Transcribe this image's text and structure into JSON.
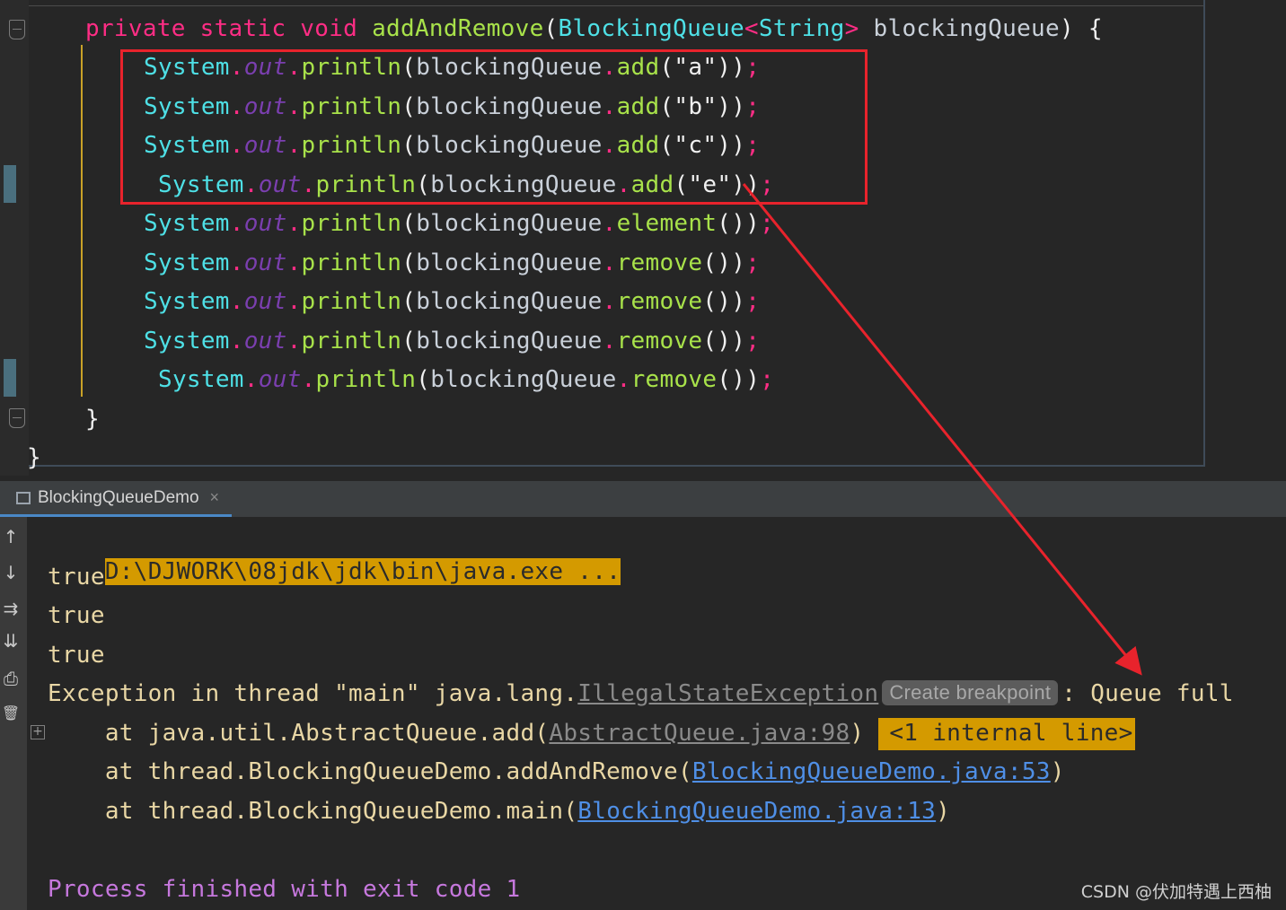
{
  "editor": {
    "lines": [
      {
        "parts": [
          [
            "kw",
            "private static void "
          ],
          [
            "def",
            "addAndRemove"
          ],
          [
            "par",
            "("
          ],
          [
            "cls",
            "BlockingQueue"
          ],
          [
            "kw",
            "<"
          ],
          [
            "cls",
            "String"
          ],
          [
            "kw",
            "> "
          ],
          [
            "plain",
            "blockingQueue"
          ],
          [
            "par",
            ") {"
          ]
        ]
      },
      {
        "parts": [
          [
            "cls",
            "System"
          ],
          [
            "dot",
            "."
          ],
          [
            "out",
            "out"
          ],
          [
            "dot",
            "."
          ],
          [
            "meth",
            "println"
          ],
          [
            "par",
            "("
          ],
          [
            "plain",
            "blockingQueue"
          ],
          [
            "dot",
            "."
          ],
          [
            "meth",
            "add"
          ],
          [
            "par",
            "("
          ],
          [
            "str",
            "\"a\""
          ],
          [
            "par",
            "))"
          ],
          [
            "semi",
            ";"
          ]
        ]
      },
      {
        "parts": [
          [
            "cls",
            "System"
          ],
          [
            "dot",
            "."
          ],
          [
            "out",
            "out"
          ],
          [
            "dot",
            "."
          ],
          [
            "meth",
            "println"
          ],
          [
            "par",
            "("
          ],
          [
            "plain",
            "blockingQueue"
          ],
          [
            "dot",
            "."
          ],
          [
            "meth",
            "add"
          ],
          [
            "par",
            "("
          ],
          [
            "str",
            "\"b\""
          ],
          [
            "par",
            "))"
          ],
          [
            "semi",
            ";"
          ]
        ]
      },
      {
        "parts": [
          [
            "cls",
            "System"
          ],
          [
            "dot",
            "."
          ],
          [
            "out",
            "out"
          ],
          [
            "dot",
            "."
          ],
          [
            "meth",
            "println"
          ],
          [
            "par",
            "("
          ],
          [
            "plain",
            "blockingQueue"
          ],
          [
            "dot",
            "."
          ],
          [
            "meth",
            "add"
          ],
          [
            "par",
            "("
          ],
          [
            "str",
            "\"c\""
          ],
          [
            "par",
            "))"
          ],
          [
            "semi",
            ";"
          ]
        ]
      },
      {
        "parts": [
          [
            "cls",
            "System"
          ],
          [
            "dot",
            "."
          ],
          [
            "out",
            "out"
          ],
          [
            "dot",
            "."
          ],
          [
            "meth",
            "println"
          ],
          [
            "par",
            "("
          ],
          [
            "plain",
            "blockingQueue"
          ],
          [
            "dot",
            "."
          ],
          [
            "meth",
            "add"
          ],
          [
            "par",
            "("
          ],
          [
            "str",
            "\"e\""
          ],
          [
            "par",
            "))"
          ],
          [
            "semi",
            ";"
          ]
        ]
      },
      {
        "parts": [
          [
            "cls",
            "System"
          ],
          [
            "dot",
            "."
          ],
          [
            "out",
            "out"
          ],
          [
            "dot",
            "."
          ],
          [
            "meth",
            "println"
          ],
          [
            "par",
            "("
          ],
          [
            "plain",
            "blockingQueue"
          ],
          [
            "dot",
            "."
          ],
          [
            "meth",
            "element"
          ],
          [
            "par",
            "())"
          ],
          [
            "semi",
            ";"
          ]
        ]
      },
      {
        "parts": [
          [
            "cls",
            "System"
          ],
          [
            "dot",
            "."
          ],
          [
            "out",
            "out"
          ],
          [
            "dot",
            "."
          ],
          [
            "meth",
            "println"
          ],
          [
            "par",
            "("
          ],
          [
            "plain",
            "blockingQueue"
          ],
          [
            "dot",
            "."
          ],
          [
            "meth",
            "remove"
          ],
          [
            "par",
            "())"
          ],
          [
            "semi",
            ";"
          ]
        ]
      },
      {
        "parts": [
          [
            "cls",
            "System"
          ],
          [
            "dot",
            "."
          ],
          [
            "out",
            "out"
          ],
          [
            "dot",
            "."
          ],
          [
            "meth",
            "println"
          ],
          [
            "par",
            "("
          ],
          [
            "plain",
            "blockingQueue"
          ],
          [
            "dot",
            "."
          ],
          [
            "meth",
            "remove"
          ],
          [
            "par",
            "())"
          ],
          [
            "semi",
            ";"
          ]
        ]
      },
      {
        "parts": [
          [
            "cls",
            "System"
          ],
          [
            "dot",
            "."
          ],
          [
            "out",
            "out"
          ],
          [
            "dot",
            "."
          ],
          [
            "meth",
            "println"
          ],
          [
            "par",
            "("
          ],
          [
            "plain",
            "blockingQueue"
          ],
          [
            "dot",
            "."
          ],
          [
            "meth",
            "remove"
          ],
          [
            "par",
            "())"
          ],
          [
            "semi",
            ";"
          ]
        ]
      },
      {
        "parts": [
          [
            "cls",
            "System"
          ],
          [
            "dot",
            "."
          ],
          [
            "out",
            "out"
          ],
          [
            "dot",
            "."
          ],
          [
            "meth",
            "println"
          ],
          [
            "par",
            "("
          ],
          [
            "plain",
            "blockingQueue"
          ],
          [
            "dot",
            "."
          ],
          [
            "meth",
            "remove"
          ],
          [
            "par",
            "())"
          ],
          [
            "semi",
            ";"
          ]
        ]
      },
      {
        "parts": [
          [
            "par",
            "}"
          ]
        ]
      },
      {
        "parts": [
          [
            "par",
            "}"
          ]
        ]
      }
    ]
  },
  "run_panel": {
    "tab_label": "BlockingQueueDemo",
    "tab_close": "×",
    "side_icons": [
      "↑",
      "↓",
      "⇉",
      "⇊",
      "⎙",
      "🗑"
    ],
    "console": {
      "command": "D:\\DJWORK\\08jdk\\jdk\\bin\\java.exe ...",
      "outputs": [
        "true",
        "true",
        "true"
      ],
      "exception_prefix": "Exception in thread \"main\" java.lang.",
      "exception_class": "IllegalStateException",
      "breakpoint_chip": "Create breakpoint",
      "exception_suffix": ": Queue full",
      "expand_symbol": "+",
      "trace": [
        {
          "prefix": "    at java.util.AbstractQueue.add(",
          "link": "AbstractQueue.java:98",
          "suffix": ")",
          "link_style": "grey",
          "internal": "<1 internal line>"
        },
        {
          "prefix": "    at thread.BlockingQueueDemo.addAndRemove(",
          "link": "BlockingQueueDemo.java:53",
          "suffix": ")",
          "link_style": "blue"
        },
        {
          "prefix": "    at thread.BlockingQueueDemo.main(",
          "link": "BlockingQueueDemo.java:13",
          "suffix": ")",
          "link_style": "blue"
        }
      ],
      "process_exit": "Process finished with exit code 1"
    }
  },
  "watermark": "CSDN @伏加特遇上西柚",
  "colors": {
    "highlight_box": "#e8232c",
    "arrow": "#e8232c",
    "command_bg": "#d49a00"
  }
}
